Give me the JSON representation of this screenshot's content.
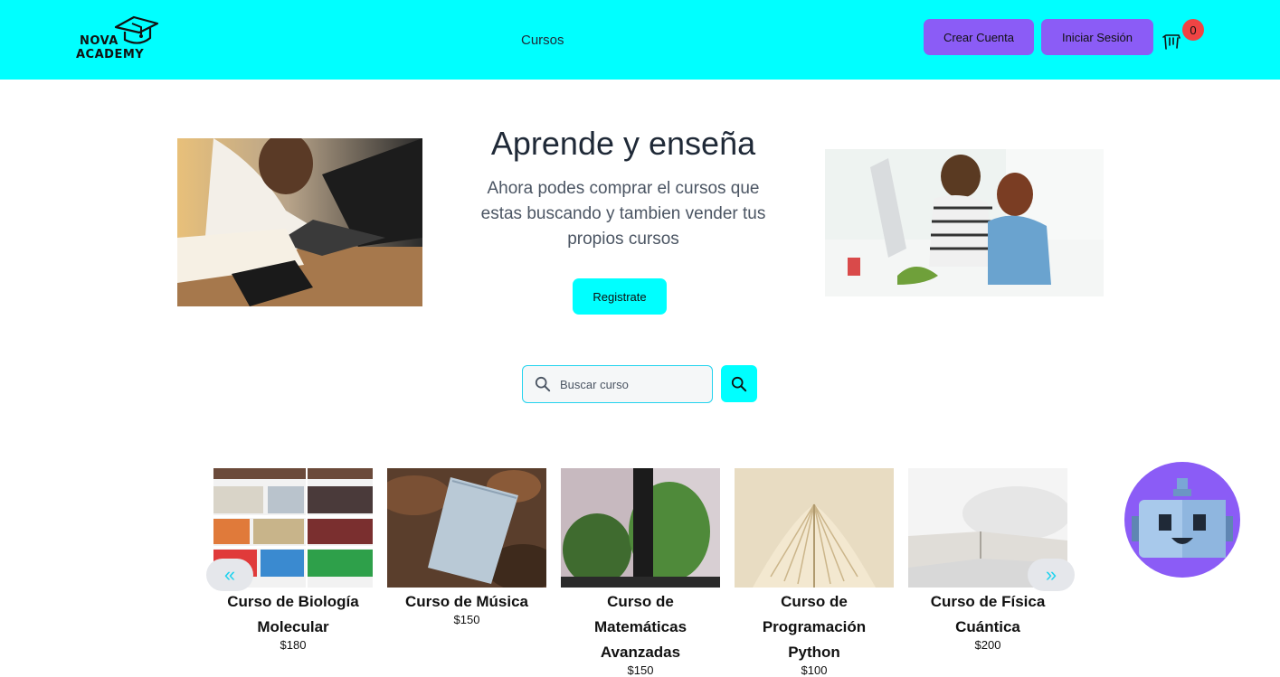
{
  "header": {
    "logo_line1": "NOVA",
    "logo_line2": "ACADEMY",
    "nav_cursos": "Cursos",
    "crear_cuenta": "Crear Cuenta",
    "iniciar_sesion": "Iniciar Sesión",
    "cart_count": "0"
  },
  "hero": {
    "title": "Aprende y enseña",
    "subtitle": "Ahora podes comprar el cursos que estas buscando y tambien vender tus propios cursos",
    "cta": "Registrate"
  },
  "search": {
    "placeholder": "Buscar curso"
  },
  "carousel": {
    "prev": "«",
    "next": "»",
    "courses": [
      {
        "title": "Curso de Biología Molecular",
        "price": "$180"
      },
      {
        "title": "Curso de Música",
        "price": "$150"
      },
      {
        "title": "Curso de Matemáticas Avanzadas",
        "price": "$150"
      },
      {
        "title": "Curso de Programación Python",
        "price": "$100"
      },
      {
        "title": "Curso de Física Cuántica",
        "price": "$200"
      }
    ]
  },
  "colors": {
    "header_bg": "#00ffff",
    "button_purple": "#8b5cf6",
    "badge_red": "#ef4444",
    "accent_cyan": "#22d3ee"
  },
  "icons": {
    "logo": "graduation-cap-icon",
    "cart": "cart-icon",
    "search": "search-icon",
    "bot": "robot-icon"
  }
}
